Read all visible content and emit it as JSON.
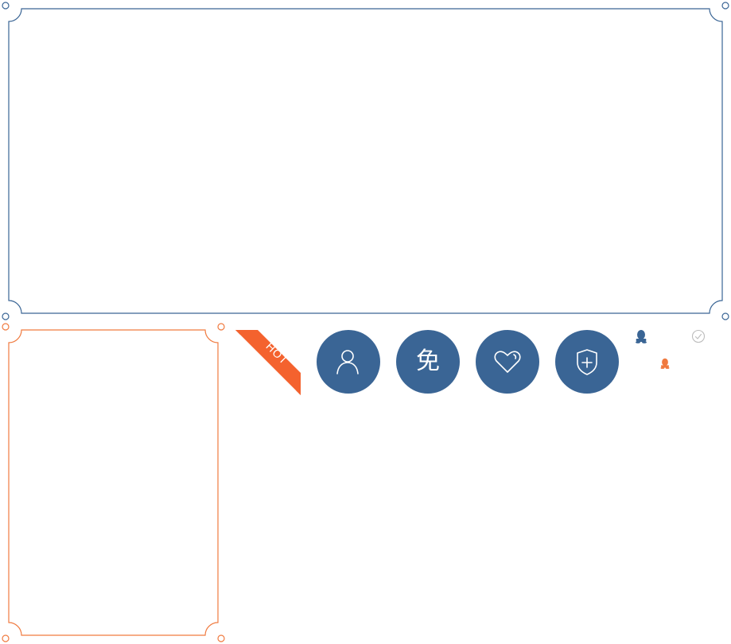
{
  "colors": {
    "blue_frame": "#3a6595",
    "orange_frame": "#f07a3f",
    "ribbon_orange": "#f4622e",
    "ribbon_dark": "#b8441c",
    "button_bg": "#3a6595",
    "check_gray": "#bdbdbd"
  },
  "ribbon": {
    "label": "HOT"
  },
  "buttons": [
    {
      "icon": "user-icon"
    },
    {
      "icon": "free-icon",
      "glyph": "免"
    },
    {
      "icon": "heart-tag-icon"
    },
    {
      "icon": "shield-plus-icon"
    }
  ],
  "small_icons": [
    {
      "icon": "qq-penguin-icon",
      "color": "#3a6595"
    },
    {
      "icon": "check-circle-icon",
      "color": "#bdbdbd"
    },
    {
      "icon": "qq-penguin-icon",
      "color": "#f07a3f"
    }
  ]
}
